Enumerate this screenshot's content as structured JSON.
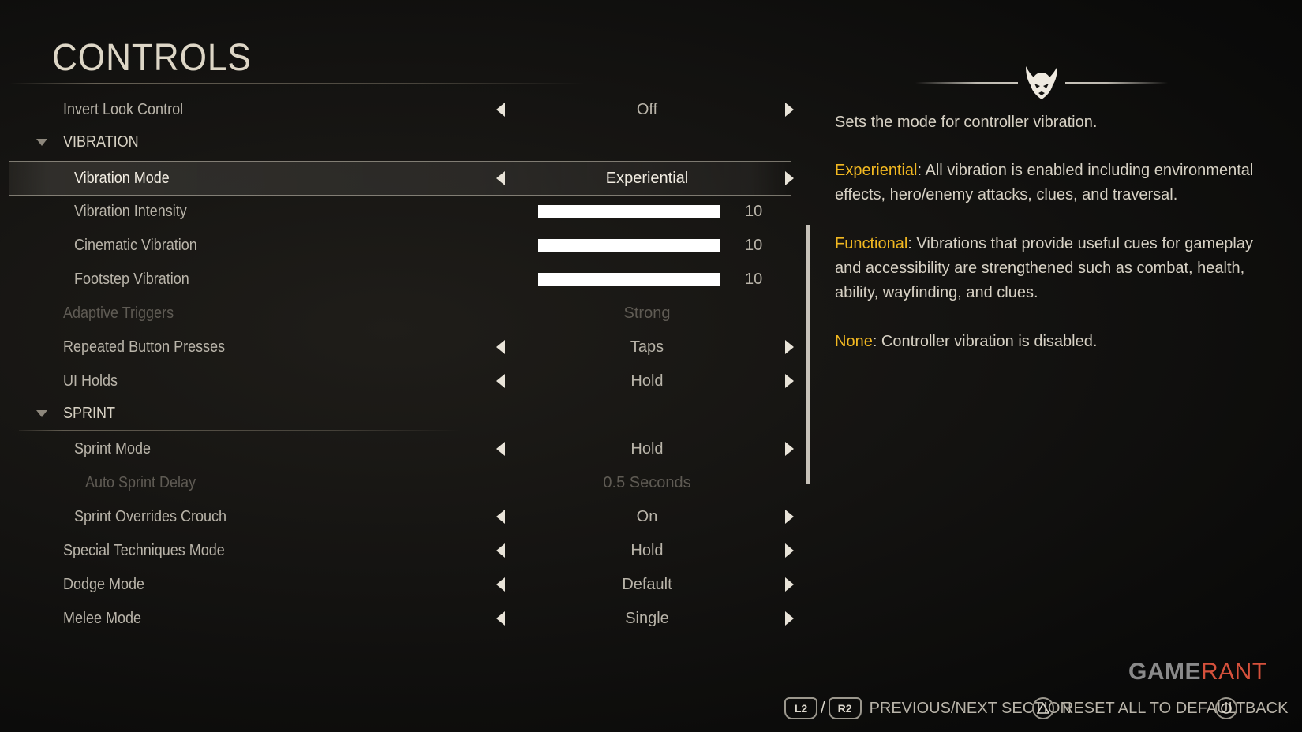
{
  "page": {
    "title": "CONTROLS"
  },
  "settings": {
    "invert_look": {
      "label": "Invert Look Control",
      "value": "Off"
    },
    "vibration_section": {
      "label": "VIBRATION"
    },
    "vibration_mode": {
      "label": "Vibration Mode",
      "value": "Experiential"
    },
    "vibration_intensity": {
      "label": "Vibration Intensity",
      "value": "10",
      "level": 1.0
    },
    "cinematic_vibration": {
      "label": "Cinematic Vibration",
      "value": "10",
      "level": 1.0
    },
    "footstep_vibration": {
      "label": "Footstep Vibration",
      "value": "10",
      "level": 1.0
    },
    "adaptive_triggers": {
      "label": "Adaptive Triggers",
      "value": "Strong"
    },
    "repeated_button_presses": {
      "label": "Repeated Button Presses",
      "value": "Taps"
    },
    "ui_holds": {
      "label": "UI Holds",
      "value": "Hold"
    },
    "sprint_section": {
      "label": "SPRINT"
    },
    "sprint_mode": {
      "label": "Sprint Mode",
      "value": "Hold"
    },
    "auto_sprint_delay": {
      "label": "Auto Sprint Delay",
      "value": "0.5 Seconds"
    },
    "sprint_overrides_crouch": {
      "label": "Sprint Overrides Crouch",
      "value": "On"
    },
    "special_techniques_mode": {
      "label": "Special Techniques Mode",
      "value": "Hold"
    },
    "dodge_mode": {
      "label": "Dodge Mode",
      "value": "Default"
    },
    "melee_mode": {
      "label": "Melee Mode",
      "value": "Single"
    }
  },
  "description": {
    "intro": "Sets the mode for controller vibration.",
    "experiential_term": "Experiential",
    "experiential_text": ": All vibration is enabled including environmental effects, hero/enemy attacks, clues, and traversal.",
    "functional_term": "Functional",
    "functional_text": ": Vibrations that provide useful cues for gameplay and accessibility are strengthened such as combat, health, ability, wayfinding, and clues.",
    "none_term": "None",
    "none_text": ": Controller vibration is disabled."
  },
  "footer": {
    "l2": "L2",
    "slash": "/",
    "r2": "R2",
    "prev_next": "PREVIOUS/NEXT SECTION",
    "reset": "RESET ALL TO DEFAULT",
    "back": "BACK"
  },
  "watermark": {
    "game": "GAME",
    "rant": "RANT"
  },
  "colors": {
    "highlight": "#f2b821",
    "text": "#b9b4a9",
    "selected_text": "#f1ece1"
  },
  "icons": {
    "emblem": "horned-mask-icon",
    "triangle": "triangle-button-icon",
    "circle": "circle-button-icon"
  }
}
